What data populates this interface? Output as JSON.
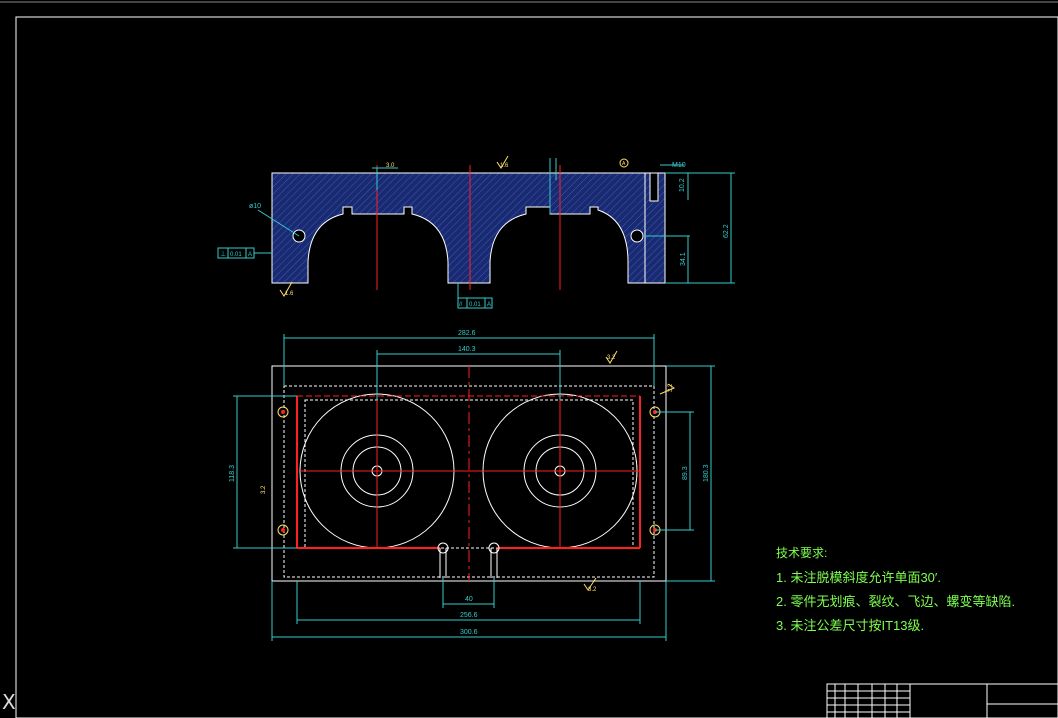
{
  "drawing": {
    "top_view": {
      "dim_hole_top": "M10",
      "dim_depth": "10.2",
      "dim_height": "62.2",
      "dim_center": "34.1",
      "dim_hole_left": "ø10",
      "flatness_symbol": "⊥",
      "flatness_tol": "0.01",
      "flatness_datum": "A",
      "parallel_symbol": "//",
      "parallel_tol": "0.01",
      "parallel_datum": "A",
      "rough_left": "1.6",
      "rough_top": "1.6",
      "width_step": "3.0",
      "datum_label": "A"
    },
    "plan_view": {
      "dim_total_top": "282.6",
      "dim_center_spacing": "140.3",
      "dim_left_height": "118.3",
      "dim_right_inner": "89.3",
      "dim_right_total": "180.3",
      "dim_slot": "40",
      "dim_bottom_inner": "256.6",
      "dim_bottom_total": "300.6",
      "rough_top_right": "3.2",
      "rough_right": "3.2",
      "rough_bottom": "3.2",
      "rough_left": "3.2"
    },
    "tech_notes": {
      "title": "技术要求:",
      "items": [
        "1. 未注脱模斜度允许单面30′.",
        "2. 零件无划痕、裂纹、飞边、螺变等缺陷.",
        "3. 未注公差尺寸按IT13级."
      ]
    },
    "ucs_icon": "X",
    "colors": {
      "background": "#000000",
      "section_fill": "#1a2a6e",
      "outline": "#ffffff",
      "dimension": "#33cccc",
      "center_line": "#ff2020",
      "text_green": "#7dff4f",
      "yellow": "#ffe066"
    }
  }
}
